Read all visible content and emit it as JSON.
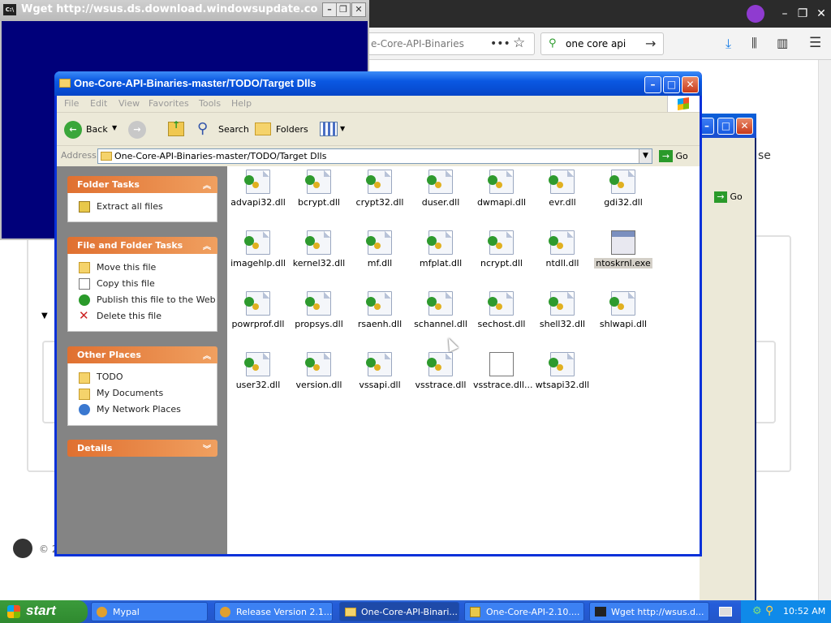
{
  "cmd": {
    "title": "Wget http://wsus.ds.download.windowsupdate.co"
  },
  "firefox": {
    "url_text": "e-Core-API-Binaries",
    "search_value": "one core api",
    "side_text": "se",
    "go_label": "Go",
    "footer_text": "© 2"
  },
  "explorer": {
    "title": "One-Core-API-Binaries-master/TODO/Target Dlls",
    "menu": [
      "File",
      "Edit",
      "View",
      "Favorites",
      "Tools",
      "Help"
    ],
    "toolbar": {
      "back": "Back",
      "search": "Search",
      "folders": "Folders"
    },
    "address_label": "Address",
    "address_value": "One-Core-API-Binaries-master/TODO/Target Dlls",
    "go_label": "Go",
    "folder_tasks": {
      "title": "Folder Tasks",
      "items": [
        "Extract all files"
      ]
    },
    "file_folder_tasks": {
      "title": "File and Folder Tasks",
      "items": [
        "Move this file",
        "Copy this file",
        "Publish this file to the Web",
        "Delete this file"
      ]
    },
    "other_places": {
      "title": "Other Places",
      "items": [
        "TODO",
        "My Documents",
        "My Network Places"
      ]
    },
    "details": {
      "title": "Details"
    },
    "files": [
      {
        "name": "advapi32.dll",
        "type": "dll"
      },
      {
        "name": "bcrypt.dll",
        "type": "dll"
      },
      {
        "name": "crypt32.dll",
        "type": "dll"
      },
      {
        "name": "duser.dll",
        "type": "dll"
      },
      {
        "name": "dwmapi.dll",
        "type": "dll"
      },
      {
        "name": "evr.dll",
        "type": "dll"
      },
      {
        "name": "gdi32.dll",
        "type": "dll"
      },
      {
        "name": "imagehlp.dll",
        "type": "dll"
      },
      {
        "name": "kernel32.dll",
        "type": "dll"
      },
      {
        "name": "mf.dll",
        "type": "dll"
      },
      {
        "name": "mfplat.dll",
        "type": "dll"
      },
      {
        "name": "ncrypt.dll",
        "type": "dll"
      },
      {
        "name": "ntdll.dll",
        "type": "dll"
      },
      {
        "name": "ntoskrnl.exe",
        "type": "exe",
        "selected": true
      },
      {
        "name": "powrprof.dll",
        "type": "dll"
      },
      {
        "name": "propsys.dll",
        "type": "dll"
      },
      {
        "name": "rsaenh.dll",
        "type": "dll"
      },
      {
        "name": "schannel.dll",
        "type": "dll"
      },
      {
        "name": "sechost.dll",
        "type": "dll"
      },
      {
        "name": "shell32.dll",
        "type": "dll"
      },
      {
        "name": "shlwapi.dll",
        "type": "dll"
      },
      {
        "name": "user32.dll",
        "type": "dll"
      },
      {
        "name": "version.dll",
        "type": "dll"
      },
      {
        "name": "vssapi.dll",
        "type": "dll"
      },
      {
        "name": "vsstrace.dll",
        "type": "dll"
      },
      {
        "name": "vsstrace.dll...",
        "type": "txt"
      },
      {
        "name": "wtsapi32.dll",
        "type": "dll"
      }
    ]
  },
  "taskbar": {
    "start": "start",
    "tasks": [
      "Mypal",
      "Release Version 2.1...",
      "One-Core-API-Binari...",
      "One-Core-API-2.10....",
      "Wget http://wsus.d..."
    ],
    "clock": "10:52 AM"
  }
}
